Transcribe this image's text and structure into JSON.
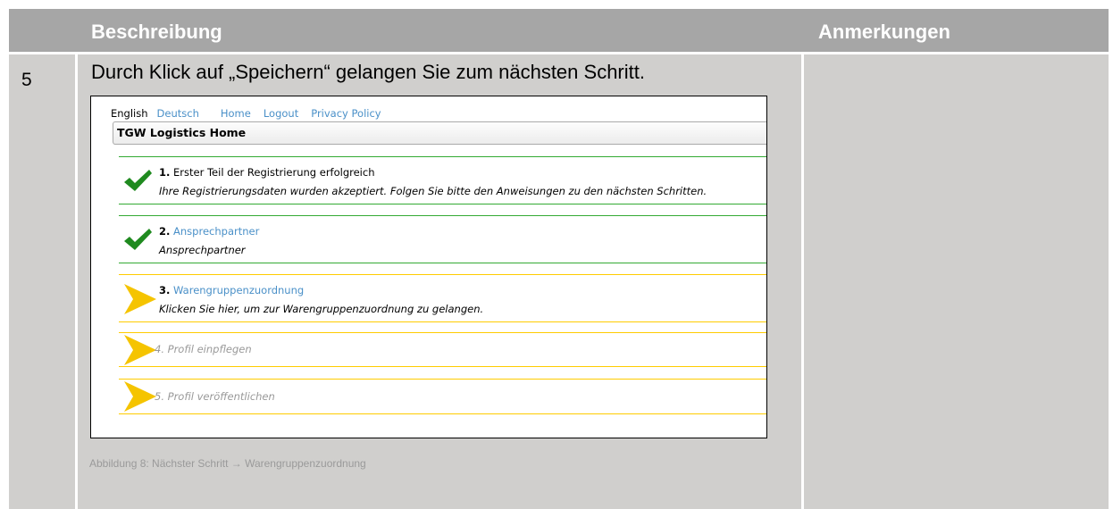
{
  "header": {
    "description": "Beschreibung",
    "notes": "Anmerkungen"
  },
  "row": {
    "step_number": "5",
    "description": "Durch Klick auf „Speichern“ gelangen Sie zum nächsten Schritt.",
    "caption": "Abbildung 8: Nächster Schritt → Warengruppenzuordnung"
  },
  "screenshot": {
    "nav": [
      "English",
      "Deutsch",
      "Home",
      "Logout",
      "Privacy Policy"
    ],
    "title": "TGW Logistics Home",
    "steps": [
      {
        "number": "1.",
        "title": "Erster Teil der Registrierung erfolgreich",
        "text": "Ihre Registrierungsdaten wurden akzeptiert. Folgen Sie bitte den Anweisungen zu den nächsten Schritten.",
        "status": "done",
        "icon": "checkmark-icon"
      },
      {
        "number": "2.",
        "title": "Ansprechpartner",
        "text": "Ansprechpartner",
        "status": "done",
        "icon": "checkmark-icon"
      },
      {
        "number": "3.",
        "title": "Warengruppenzuordnung",
        "text": "Klicken Sie hier, um zur Warengruppenzuordnung zu gelangen.",
        "status": "current",
        "icon": "arrow-right-icon"
      },
      {
        "label": "4. Profil einpflegen",
        "status": "pending",
        "icon": "arrow-right-icon"
      },
      {
        "label": "5. Profil veröffentlichen",
        "status": "pending",
        "icon": "arrow-right-icon"
      }
    ],
    "colors": {
      "done": "#33aa33",
      "pending": "#ffcc00",
      "link": "#4a90c8",
      "check": "#1f8a1f",
      "arrow": "#f5c400"
    }
  }
}
